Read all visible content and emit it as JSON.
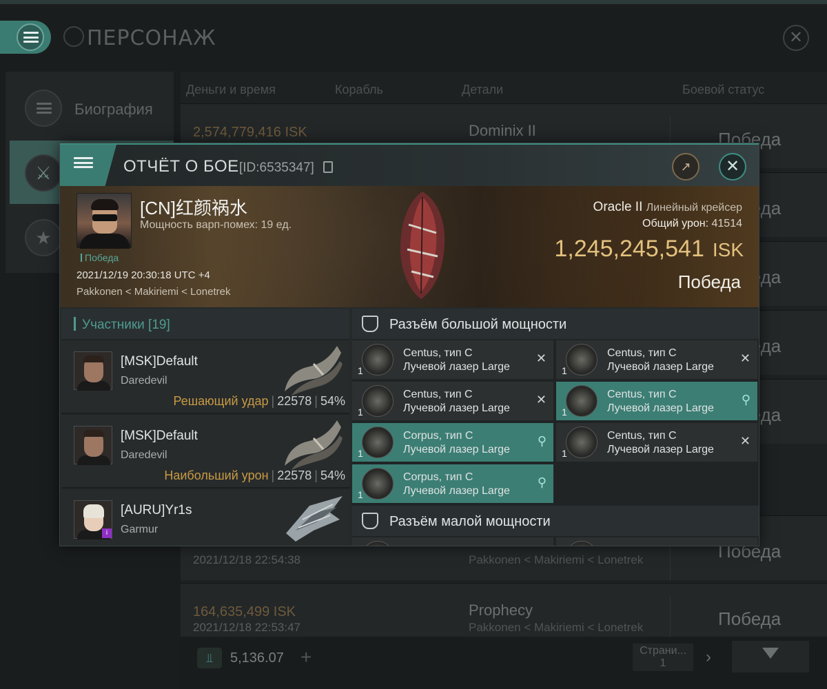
{
  "page": {
    "title": "ПЕРСОНАЖ",
    "nav": [
      {
        "label": "Биография",
        "icon": "biography-icon"
      },
      {
        "label": "",
        "icon": "combat-icon"
      },
      {
        "label": "",
        "icon": "star-icon"
      }
    ],
    "columns": [
      "Деньги и время",
      "Корабль",
      "Детали",
      "Боевой статус"
    ],
    "rows": [
      {
        "money": "2,574,779,416  ISK",
        "date": "",
        "ship": "Dominix II",
        "loc": "",
        "status": "Победа"
      },
      {
        "money": "",
        "date": "",
        "ship": "",
        "loc": "",
        "status": "Победа"
      },
      {
        "money": "",
        "date": "",
        "ship": "",
        "loc": "",
        "status": "Победа"
      },
      {
        "money": "",
        "date": "",
        "ship": "",
        "loc": "",
        "status": "Победа"
      },
      {
        "money": "",
        "date": "",
        "ship": "",
        "loc": "",
        "status": "Победа"
      },
      {
        "money": "",
        "date": "2021/12/18   22:54:38",
        "ship": "",
        "loc": "Pakkonen < Makiriemi < Lonetrek",
        "status": "Победа"
      },
      {
        "money": "164,635,499  ISK",
        "date": "2021/12/18   22:53:47",
        "ship": "Prophecy",
        "loc": "Pakkonen < Makiriemi < Lonetrek",
        "status": "Победа"
      }
    ],
    "wallet": "5,136.07",
    "pager": {
      "label": "Страни...",
      "page": "1"
    }
  },
  "dialog": {
    "title": "ОТЧЁТ О БОЕ",
    "id": "[ID:6535347]",
    "victim": {
      "name": "[CN]红颜祸水",
      "warp": "Мощность варп-помех: 19 ед.",
      "status": "Победа",
      "date": "2021/12/19 20:30:18 UTC +4",
      "location": "Pakkonen < Makiriemi < Lonetrek"
    },
    "ship": {
      "name": "Oracle II",
      "class": "Линейный крейсер",
      "damage_label": "Общий урон:",
      "damage": "41514",
      "isk": "1,245,245,541",
      "isk_unit": "ISK",
      "result": "Победа"
    },
    "participants_label": "Участники [19]",
    "participants": [
      {
        "name": "[MSK]Default",
        "ship": "Daredevil",
        "tag": "Решающий удар",
        "damage": "22578",
        "pct": "54%"
      },
      {
        "name": "[MSK]Default",
        "ship": "Daredevil",
        "tag": "Наибольший урон",
        "damage": "22578",
        "pct": "54%"
      },
      {
        "name": "[AURU]Yr1s",
        "ship": "Garmur",
        "tag": "",
        "damage": "",
        "pct": ""
      }
    ],
    "high_slots_label": "Разъём большой мощности",
    "low_slots_label": "Разъём малой мощности",
    "modules": [
      {
        "qty": "1",
        "name": "Centus, тип C",
        "type": "Лучевой лазер Large",
        "state": "destroyed"
      },
      {
        "qty": "1",
        "name": "Centus, тип C",
        "type": "Лучевой лазер Large",
        "state": "destroyed"
      },
      {
        "qty": "1",
        "name": "Centus, тип C",
        "type": "Лучевой лазер Large",
        "state": "destroyed"
      },
      {
        "qty": "1",
        "name": "Centus, тип C",
        "type": "Лучевой лазер Large",
        "state": "dropped"
      },
      {
        "qty": "1",
        "name": "Corpus, тип C",
        "type": "Лучевой лазер Large",
        "state": "dropped"
      },
      {
        "qty": "1",
        "name": "Centus, тип C",
        "type": "Лучевой лазер Large",
        "state": "destroyed"
      },
      {
        "qty": "1",
        "name": "Corpus, тип C",
        "type": "Лучевой лазер Large",
        "state": "dropped"
      }
    ]
  },
  "colors": {
    "accent": "#3b7c72",
    "isk": "#e3c27f",
    "tag": "#c89a43"
  }
}
